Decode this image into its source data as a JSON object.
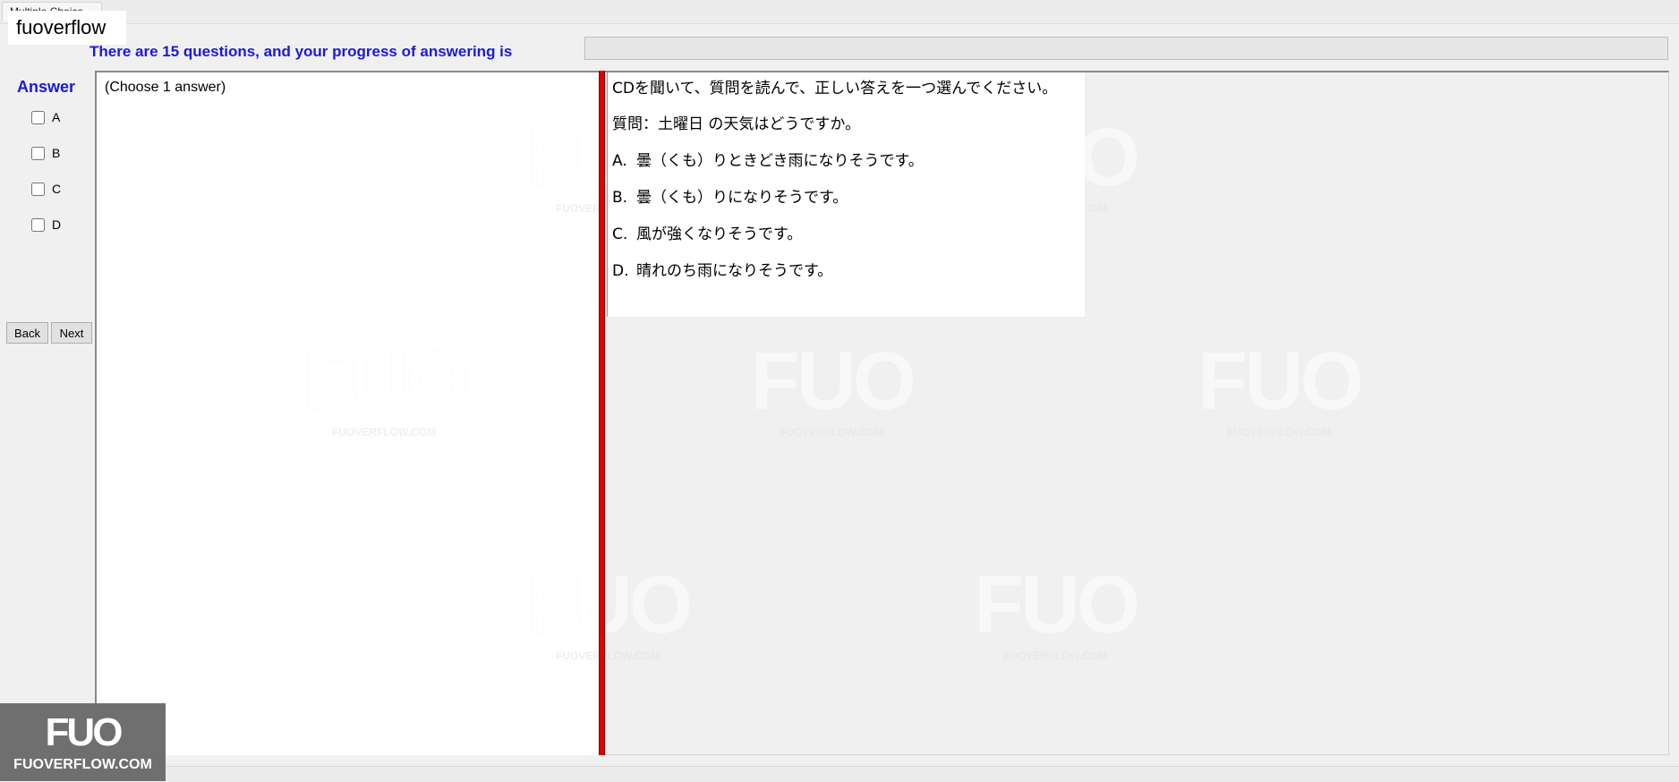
{
  "window": {
    "tab_label": "Multiple Choice",
    "brand_label": "fuoverflow"
  },
  "header": {
    "progress_text": "There are 15 questions, and your progress of answering is",
    "progress_fraction": 0
  },
  "answer_panel": {
    "heading": "Answer",
    "options": [
      {
        "label": "A",
        "checked": false
      },
      {
        "label": "B",
        "checked": false
      },
      {
        "label": "C",
        "checked": false
      },
      {
        "label": "D",
        "checked": false
      }
    ],
    "back_label": "Back",
    "next_label": "Next"
  },
  "left_panel": {
    "instruction": "(Choose 1 answer)"
  },
  "question": {
    "instruction": "CDを聞いて、質問を読んで、正しい答えを一つ選んでください。",
    "prompt": "質問：土曜日 の天気はどうですか。",
    "options": [
      {
        "letter": "A.",
        "text": "曇（くも）りときどき雨になりそうです。"
      },
      {
        "letter": "B.",
        "text": "曇（くも）りになりそうです。"
      },
      {
        "letter": "C.",
        "text": "風が強くなりそうです。"
      },
      {
        "letter": "D.",
        "text": "晴れのち雨になりそうです。"
      }
    ]
  },
  "watermark": {
    "mark": "FUO",
    "site": "FUOVERFLOW.COM"
  },
  "colors": {
    "accent_blue": "#1a1ad6",
    "splitter_red": "#e00000"
  }
}
